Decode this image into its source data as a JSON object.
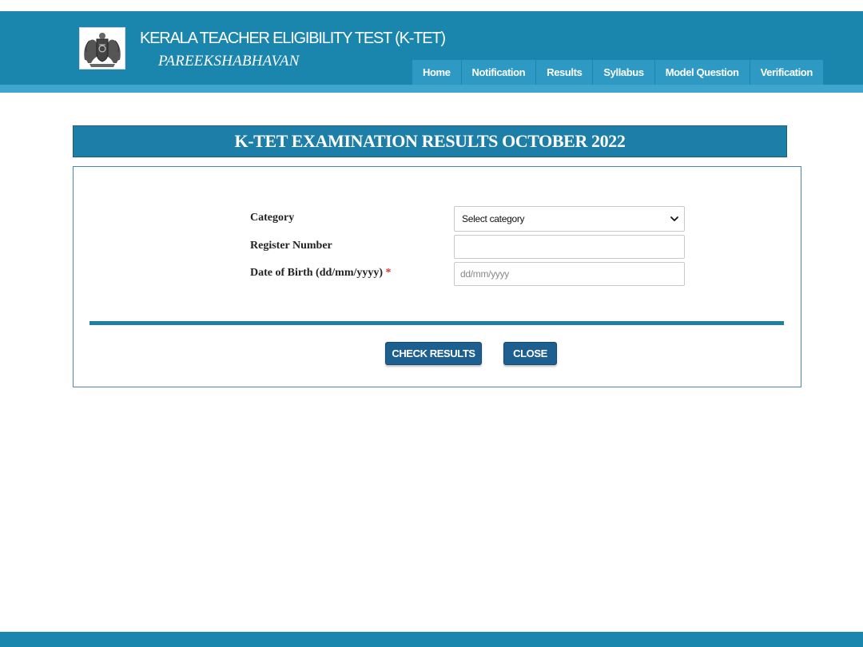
{
  "header": {
    "title": "KERALA TEACHER ELIGIBILITY TEST (K-TET)",
    "subtitle": "PAREEKSHABHAVAN"
  },
  "nav": {
    "items": [
      {
        "label": "Home"
      },
      {
        "label": "Notification"
      },
      {
        "label": "Results"
      },
      {
        "label": "Syllabus"
      },
      {
        "label": "Model Question"
      },
      {
        "label": "Verification"
      }
    ]
  },
  "main": {
    "banner": "K-TET EXAMINATION RESULTS OCTOBER 2022",
    "form": {
      "category_label": "Category",
      "category_selected": "Select category",
      "register_label": "Register Number",
      "register_value": "",
      "dob_label": "Date of Birth (dd/mm/yyyy)",
      "dob_required_mark": "*",
      "dob_placeholder": "dd/mm/yyyy"
    },
    "buttons": {
      "check_results": "CHECK RESULTS",
      "close": "CLOSE"
    }
  },
  "colors": {
    "header": "#1a85ad",
    "nav_item": "#2e9ac4",
    "banner": "#1d7fa8",
    "button": "#1d5f8e",
    "required": "#e03131"
  },
  "icons": {
    "emblem": "kerala-state-emblem-icon",
    "dropdown": "chevron-down-icon"
  }
}
